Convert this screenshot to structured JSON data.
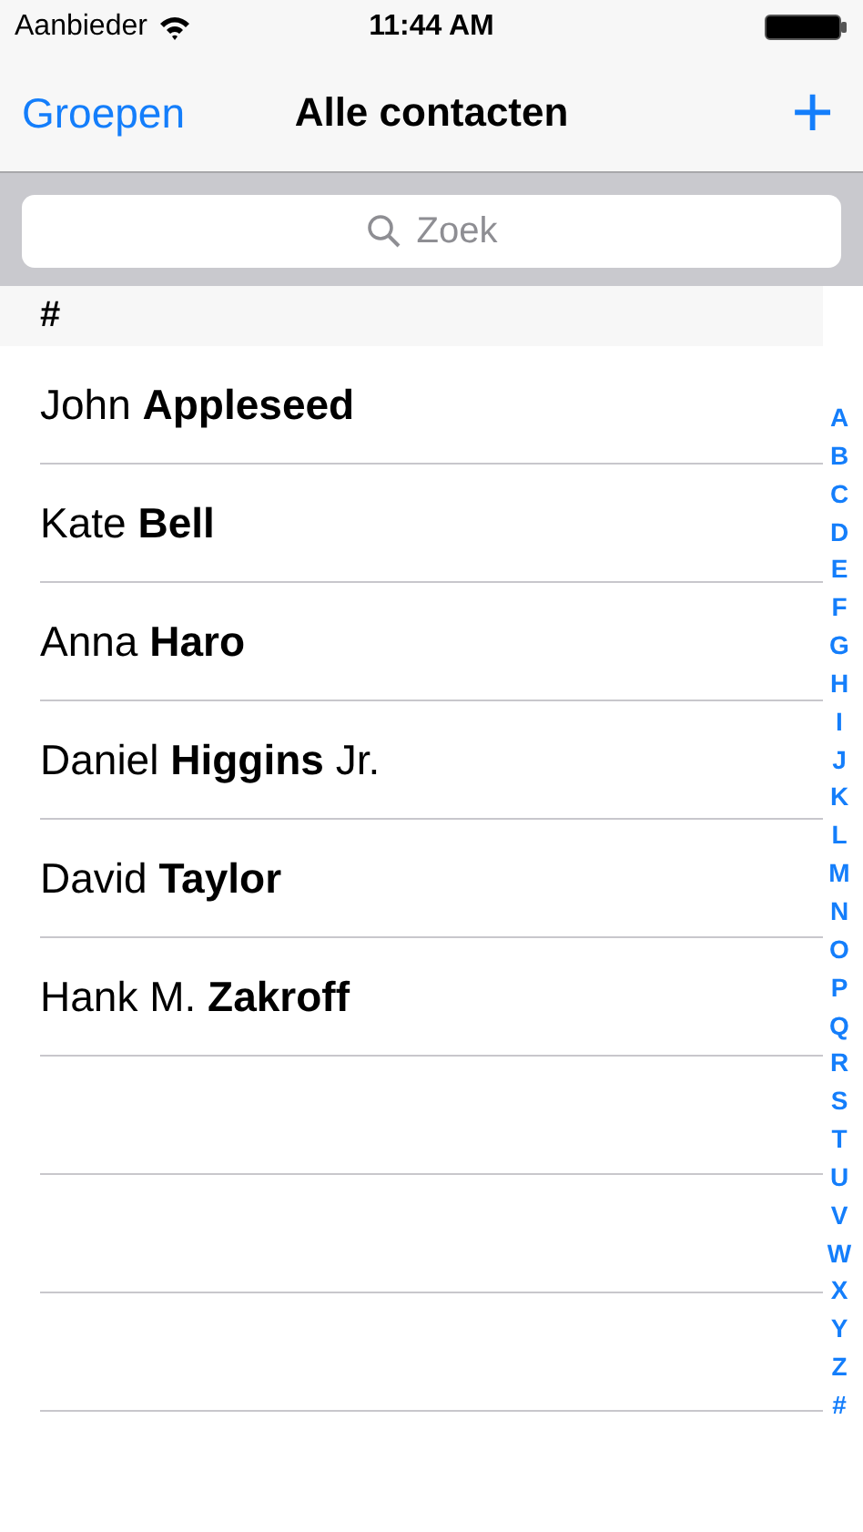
{
  "status_bar": {
    "carrier": "Aanbieder",
    "time": "11:44 AM"
  },
  "nav_bar": {
    "back": "Groepen",
    "title": "Alle contacten",
    "add": "+"
  },
  "search": {
    "placeholder": "Zoek"
  },
  "section": {
    "header": "#",
    "contacts": [
      {
        "name": "John **Appleseed**"
      },
      {
        "name": "Kate **Bell**"
      },
      {
        "name": "Anna **Haro**"
      },
      {
        "name": "Daniel **Higgins** Jr."
      },
      {
        "name": "David **Taylor**"
      },
      {
        "name": "Hank M. **Zakroff**"
      }
    ]
  },
  "index": [
    "A",
    "B",
    "C",
    "D",
    "E",
    "F",
    "G",
    "H",
    "I",
    "J",
    "K",
    "L",
    "M",
    "N",
    "O",
    "P",
    "Q",
    "R",
    "S",
    "T",
    "U",
    "V",
    "W",
    "X",
    "Y",
    "Z",
    "#"
  ]
}
